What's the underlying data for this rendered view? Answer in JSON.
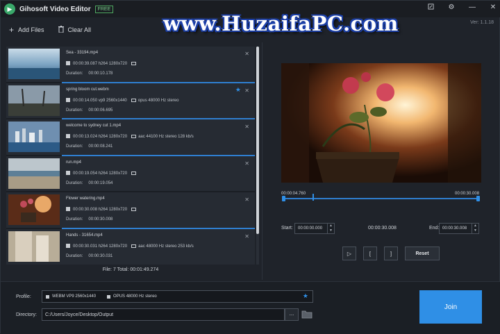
{
  "app": {
    "title": "Gihosoft Video Editor",
    "badge": "FREE",
    "version": "Ver: 1.1.18"
  },
  "watermark": "www.HuzaifaPC.com",
  "window": {
    "edit_icon": "edit-icon",
    "settings_icon": "gear-icon",
    "min": "—",
    "close": "✕"
  },
  "toolbar": {
    "add_label": "Add Files",
    "clear_label": "Clear All"
  },
  "files": [
    {
      "name": "Sea - 33194.mp4",
      "info": "00:00:39.087 h264 1280x720",
      "audio": "",
      "duration_label": "Duration:",
      "duration": "00:00:10.178",
      "active": true,
      "starred": false
    },
    {
      "name": "spring bloom cut.webm",
      "info": "00:00:14.050 vp9 2560x1440",
      "audio": "opus 48000 Hz stereo",
      "duration_label": "Duration:",
      "duration": "00:00:06.695",
      "active": true,
      "starred": true
    },
    {
      "name": "welcome to sydney cut 1.mp4",
      "info": "00:00:13.024 h264 1280x720",
      "audio": "aac 44100 Hz stereo  128 kb/s",
      "duration_label": "Duration:",
      "duration": "00:00:08.241",
      "active": true,
      "starred": false
    },
    {
      "name": "run.mp4",
      "info": "00:00:19.054 h264 1280x720",
      "audio": "",
      "duration_label": "Duration:",
      "duration": "00:00:19.054",
      "active": false,
      "starred": false
    },
    {
      "name": "Flower watering.mp4",
      "info": "00:00:30.008 h264 1280x720",
      "audio": "",
      "duration_label": "Duration:",
      "duration": "00:00:30.008",
      "active": true,
      "starred": false
    },
    {
      "name": "Hands - 31654.mp4",
      "info": "00:00:30.031 h264 1280x720",
      "audio": "aac 48000 Hz stereo  253 kb/s",
      "duration_label": "Duration:",
      "duration": "00:00:30.031",
      "active": false,
      "starred": false
    }
  ],
  "summary": "File: 7   Total: 00:01:49.274",
  "player": {
    "current_time": "00:00:04.760",
    "end_time": "00:00:30.008",
    "start_label": "Start:",
    "start_value": "00:00:00.000",
    "mid_value": "00:00:30.008",
    "end_label": "End:",
    "end_value": "00:00:30.008",
    "play_icon": "▷",
    "mark_in": "[",
    "mark_out": "]",
    "reset_label": "Reset"
  },
  "output": {
    "profile_label": "Profile:",
    "profile_video": "WEBM VP9 2560x1440",
    "profile_audio": "OPUS 48000 Hz stereo",
    "directory_label": "Directory:",
    "directory_value": "C:/Users/Joyce/Desktop/Output",
    "browse_label": "...",
    "join_label": "Join"
  },
  "colors": {
    "accent": "#2f8fe6",
    "background": "#1f232a",
    "panel": "#262b33"
  }
}
